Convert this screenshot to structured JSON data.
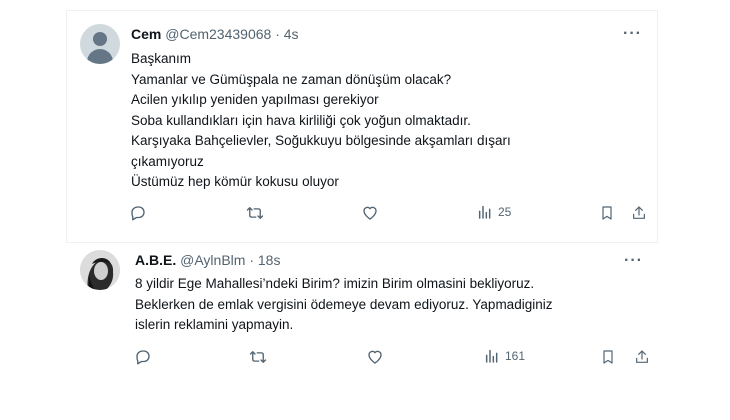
{
  "tweets": [
    {
      "name": "Cem",
      "handle": "@Cem23439068",
      "separator": "·",
      "time": "4s",
      "avatar": "default-avatar",
      "lines": [
        "Başkanım",
        "Yamanlar ve Gümüşpala ne zaman dönüşüm olacak?",
        "Acilen yıkılıp yeniden yapılması gerekiyor",
        "Soba kullandıkları için hava kirliliği çok yoğun olmaktadır.",
        "Karşıyaka Bahçelievler, Soğukkuyu bölgesinde  akşamları dışarı",
        "çıkamıyoruz",
        "Üstümüz hep kömür kokusu oluyor"
      ],
      "more_label": "···",
      "views": "25"
    },
    {
      "name": "A.B.E.",
      "handle": "@AylnBlm",
      "separator": "·",
      "time": "18s",
      "avatar": "photo-avatar",
      "lines": [
        "8 yildir Ege Mahallesi’ndeki Birim? imizin Birim olmasini bekliyoruz.",
        "Beklerken de emlak vergisini ödemeye devam ediyoruz. Yapmadiginiz",
        "islerin reklamini yapmayin."
      ],
      "more_label": "···",
      "views": "161"
    }
  ],
  "icons": {
    "reply": "reply-icon",
    "retweet": "retweet-icon",
    "like": "like-icon",
    "views": "views-icon",
    "bookmark": "bookmark-icon",
    "share": "share-icon"
  },
  "colors": {
    "icon": "#536471",
    "text": "#0f1419",
    "handle": "#536471"
  }
}
